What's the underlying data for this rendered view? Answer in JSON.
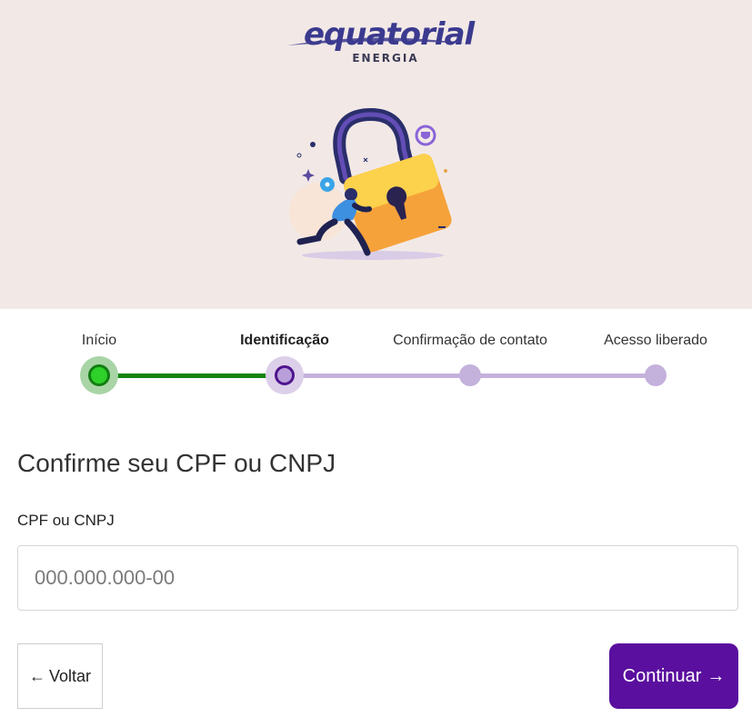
{
  "brand": {
    "name": "equatorial",
    "subtitle": "ENERGIA",
    "color": "#3b3a8f"
  },
  "hero": {
    "background": "#f2e9e6",
    "illustration": "padlock-with-running-person"
  },
  "stepper": {
    "steps": [
      {
        "label": "Início",
        "state": "done"
      },
      {
        "label": "Identificação",
        "state": "current"
      },
      {
        "label": "Confirmação de contato",
        "state": "todo"
      },
      {
        "label": "Acesso liberado",
        "state": "todo"
      }
    ],
    "colors": {
      "done": "#12850f",
      "current": "#4f158e",
      "todo": "#c4b1dc"
    }
  },
  "form": {
    "title": "Confirme seu CPF ou CNPJ",
    "field_label": "CPF ou CNPJ",
    "field_placeholder": "000.000.000-00",
    "field_value": ""
  },
  "actions": {
    "back_label": "Voltar",
    "back_arrow": "←",
    "next_label": "Continuar",
    "next_arrow": "→",
    "accent": "#5a0f9e"
  }
}
